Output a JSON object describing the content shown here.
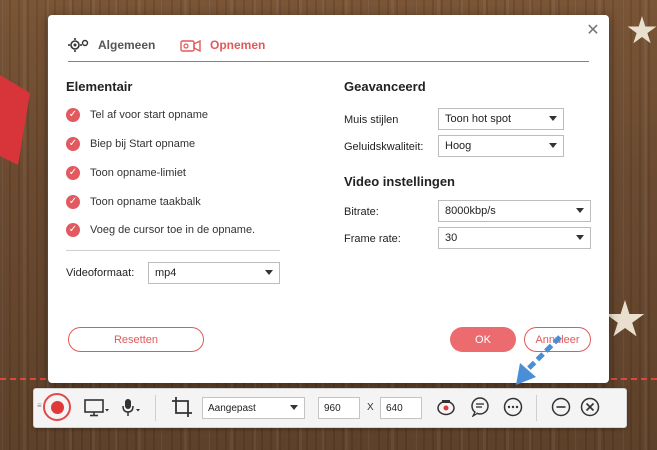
{
  "tabs": {
    "general": "Algemeen",
    "record": "Opnemen"
  },
  "basic": {
    "title": "Elementair",
    "options": [
      "Tel af voor start opname",
      "Biep bij Start opname",
      "Toon opname-limiet",
      "Toon opname taakbalk",
      "Voeg de cursor toe in de opname."
    ],
    "video_format_label": "Videoformaat:",
    "video_format_value": "mp4"
  },
  "advanced": {
    "title": "Geavanceerd",
    "mouse_style_label": "Muis stijlen",
    "mouse_style_value": "Toon hot spot",
    "sound_quality_label": "Geluidskwaliteit:",
    "sound_quality_value": "Hoog"
  },
  "video_settings": {
    "title": "Video instellingen",
    "bitrate_label": "Bitrate:",
    "bitrate_value": "8000kbp/s",
    "framerate_label": "Frame rate:",
    "framerate_value": "30"
  },
  "buttons": {
    "reset": "Resetten",
    "ok": "OK",
    "cancel": "Annuleer"
  },
  "toolbar": {
    "size_preset": "Aangepast",
    "width": "960",
    "height": "640",
    "x_sep": "X"
  },
  "colors": {
    "accent": "#e05a5a",
    "ok_button": "#eb6b6f"
  }
}
